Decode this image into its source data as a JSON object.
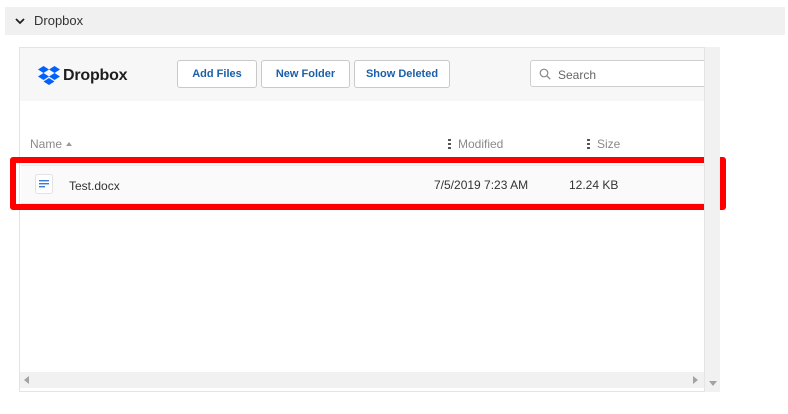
{
  "section": {
    "title": "Dropbox"
  },
  "toolbar": {
    "logo_text": "Dropbox",
    "add_files": "Add Files",
    "new_folder": "New Folder",
    "show_deleted": "Show Deleted",
    "search_placeholder": "Search"
  },
  "columns": {
    "name": "Name",
    "modified": "Modified",
    "size": "Size"
  },
  "files": [
    {
      "name": "Test.docx",
      "modified": "7/5/2019 7:23 AM",
      "size": "12.24 KB",
      "icon": "document-icon"
    }
  ],
  "colors": {
    "accent": "#1a5fa8",
    "brand": "#0061fe",
    "highlight": "#ff0000"
  },
  "icons": {
    "section_toggle": "chevron-down-icon",
    "logo": "dropbox-logo-icon",
    "search": "search-icon",
    "column_menu": "kebab-icon",
    "sort": "sort-ascending-icon"
  }
}
